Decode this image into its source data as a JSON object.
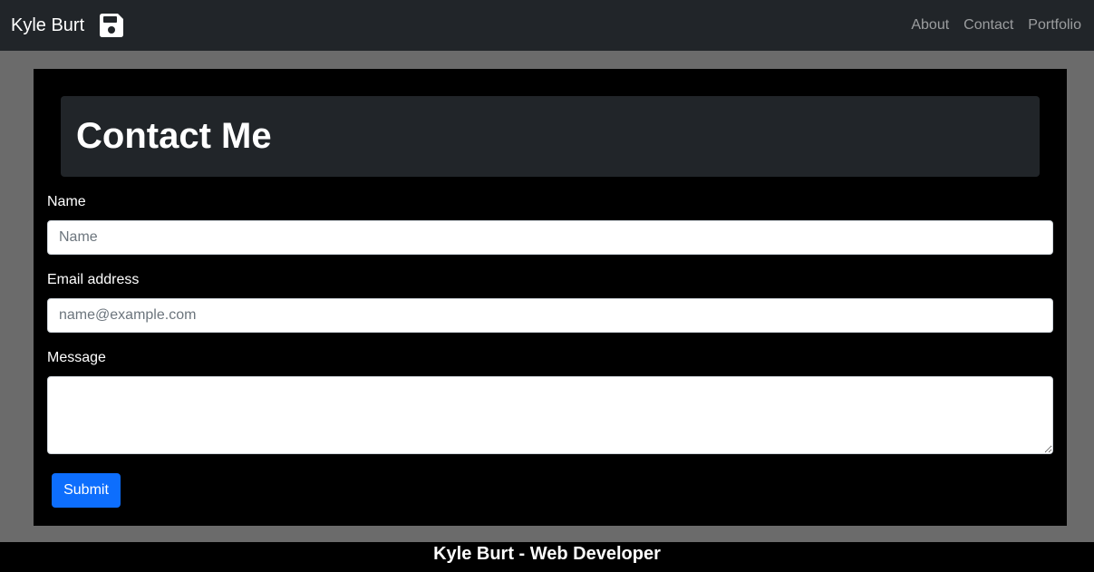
{
  "navbar": {
    "brand": "Kyle Burt",
    "brand_icon": "floppy-disk-icon",
    "links": [
      "About",
      "Contact",
      "Portfolio"
    ]
  },
  "main": {
    "heading": "Contact Me",
    "form": {
      "name_label": "Name",
      "name_placeholder": "Name",
      "email_label": "Email address",
      "email_placeholder": "name@example.com",
      "message_label": "Message",
      "message_value": "",
      "submit_label": "Submit"
    }
  },
  "footer": {
    "text": "Kyle Burt - Web Developer"
  },
  "colors": {
    "navbar_bg": "#212529",
    "page_bg": "#6b6b6b",
    "content_bg": "#000000",
    "accent": "#0d6efd"
  }
}
